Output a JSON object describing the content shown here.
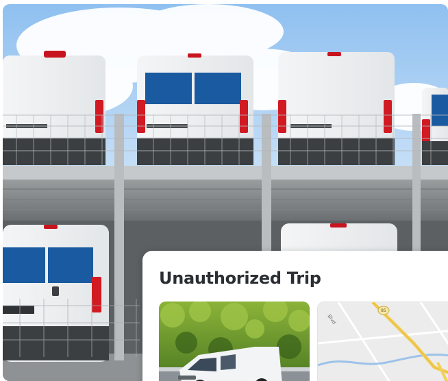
{
  "card": {
    "title": "Unauthorized Trip",
    "map_labels": {
      "road": "Blvd",
      "shield": "85"
    }
  },
  "colors": {
    "sky": "#a9cff5",
    "card_background": "#ffffff",
    "title_text": "#2b2f33",
    "map_highway": "#f3cf5a",
    "map_water": "#9cc2ea"
  }
}
